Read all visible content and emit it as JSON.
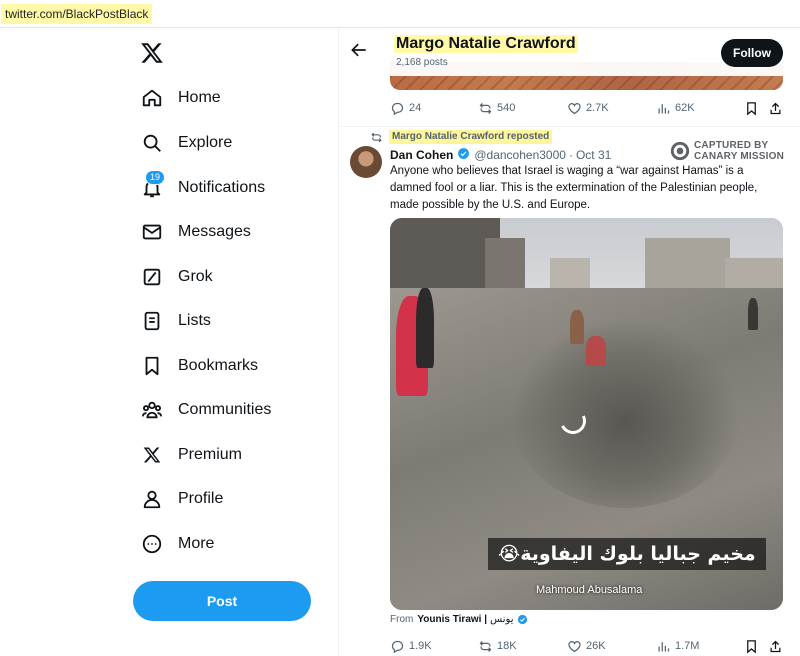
{
  "browser": {
    "url": "twitter.com/BlackPostBlack"
  },
  "sidebar": {
    "logo_icon": "x-logo-icon",
    "items": [
      {
        "label": "Home",
        "icon": "home-icon"
      },
      {
        "label": "Explore",
        "icon": "search-icon"
      },
      {
        "label": "Notifications",
        "icon": "bell-icon",
        "badge": "19"
      },
      {
        "label": "Messages",
        "icon": "envelope-icon"
      },
      {
        "label": "Grok",
        "icon": "grok-icon"
      },
      {
        "label": "Lists",
        "icon": "list-icon"
      },
      {
        "label": "Bookmarks",
        "icon": "bookmark-icon"
      },
      {
        "label": "Communities",
        "icon": "people-icon"
      },
      {
        "label": "Premium",
        "icon": "x-logo-icon"
      },
      {
        "label": "Profile",
        "icon": "person-icon"
      },
      {
        "label": "More",
        "icon": "more-circle-icon"
      }
    ],
    "post_label": "Post"
  },
  "header": {
    "name": "Margo Natalie Crawford",
    "post_count": "2,168 posts",
    "follow_label": "Follow"
  },
  "previous_post": {
    "replies": "24",
    "reposts": "540",
    "likes": "2.7K",
    "views": "62K"
  },
  "post": {
    "repost_label": "Margo Natalie Crawford reposted",
    "author_name": "Dan Cohen",
    "handle": "@dancohen3000",
    "date": "Oct 31",
    "text": "Anyone who believes that Israel is waging a “war against Hamas” is a damned fool or a liar. This is the extermination of the Palestinian people, made possible by the U.S. and Europe.",
    "watermark_line1": "CAPTURED BY",
    "watermark_line2": "CANARY MISSION",
    "video_caption": "مخيم جباليا بلوك اليفاوية😭",
    "video_credit": "Mahmoud Abusalama",
    "from_prefix": "From",
    "from_name": "Younis Tirawi |",
    "from_name_ar": "يونس",
    "replies": "1.9K",
    "reposts": "18K",
    "likes": "26K",
    "views": "1.7M"
  },
  "colors": {
    "accent": "#1d9bf0",
    "highlight": "#fff9a8",
    "text_secondary": "#536471"
  }
}
